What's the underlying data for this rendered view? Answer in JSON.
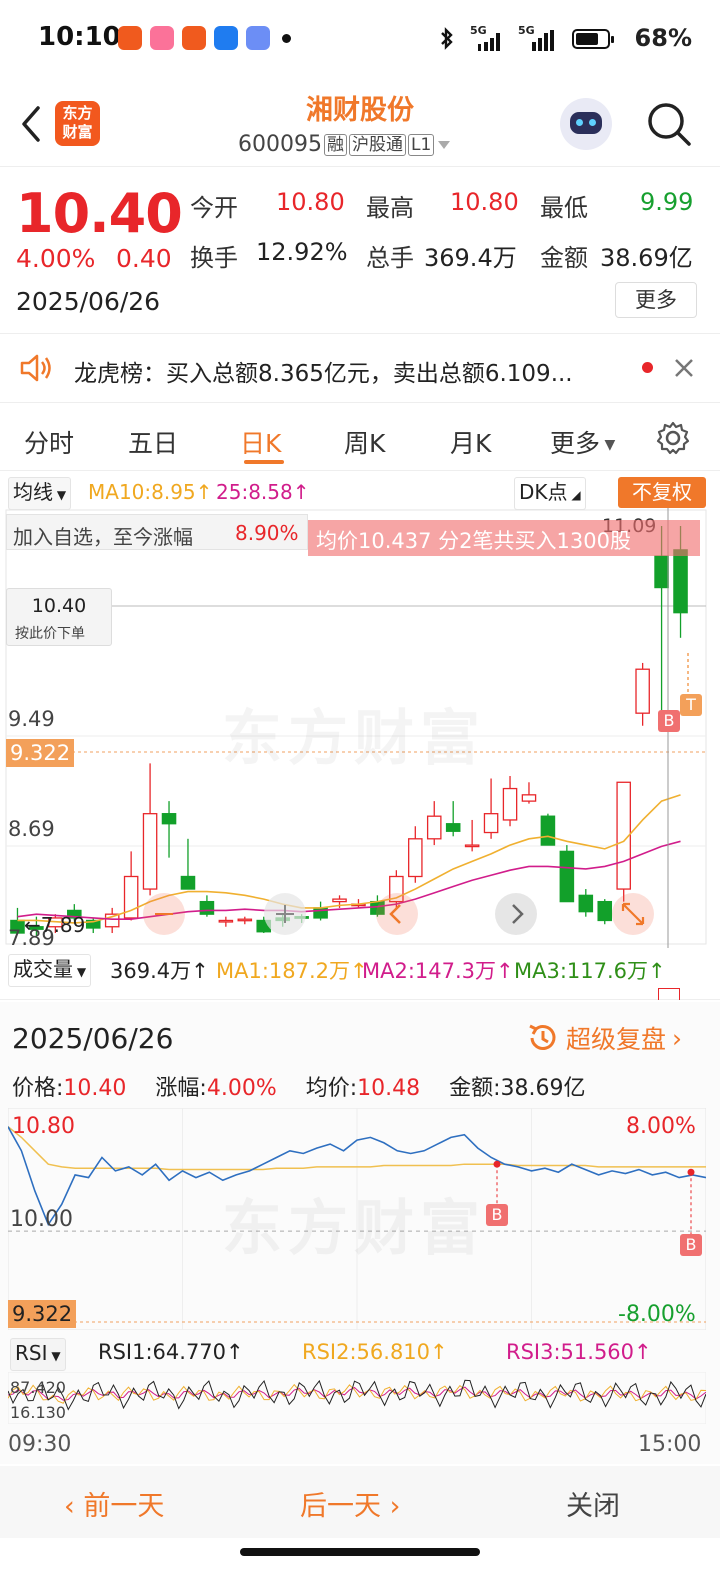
{
  "status_bar": {
    "time": "10:10",
    "battery": "68%",
    "signal1": "5G",
    "signal2": "5G"
  },
  "header": {
    "title": "湘财股份",
    "code": "600095",
    "tag_rong": "融",
    "tag_hgt": "沪股通",
    "tag_level": "L1",
    "logo_line1": "东方",
    "logo_line2": "财富"
  },
  "quote": {
    "price": "10.40",
    "change_pct": "4.00%",
    "change_val": "0.40",
    "date": "2025/06/26",
    "open_label": "今开",
    "open": "10.80",
    "high_label": "最高",
    "high": "10.80",
    "low_label": "最低",
    "low": "9.99",
    "turnover_label": "换手",
    "turnover": "12.92%",
    "volume_label": "总手",
    "volume": "369.4万",
    "amount_label": "金额",
    "amount": "38.69亿",
    "more_label": "更多"
  },
  "notice": {
    "text": "龙虎榜：买入总额8.365亿元，卖出总额6.109..."
  },
  "tabs": [
    "分时",
    "五日",
    "日K",
    "周K",
    "月K",
    "更多"
  ],
  "active_tab": "日K",
  "kline": {
    "ma_select": "均线",
    "ma10": "MA10:8.95↑",
    "ma25": "25:8.58↑",
    "dk_label": "DK点",
    "fq_label": "不复权",
    "watch_text": "加入自选，至今涨幅",
    "watch_pct": "8.90%",
    "avg_banner": "均价10.437  分2笔共买入1300股",
    "price_box": "10.40",
    "price_box_sub": "按此价下单",
    "high_label": "11.09",
    "y_labels": [
      "9.49",
      "8.69",
      "7.89"
    ],
    "cost_label": "9.322",
    "low_label": "7.89",
    "b_mark": "B",
    "t_mark": "T",
    "watermark": "东方财富",
    "vol_select": "成交量",
    "vol_val": "369.4万↑",
    "ma1": "MA1:187.2万↑",
    "ma2": "MA2:147.3万↑",
    "ma3": "MA3:117.6万↑",
    "colors": {
      "up": "#e8262a",
      "down": "#12a02a",
      "ma10": "#f0b030",
      "ma25": "#d11d8b"
    }
  },
  "chart_data": [
    {
      "type": "candlestick",
      "title": "",
      "ylim": [
        7.89,
        11.09
      ],
      "candles": [
        {
          "o": 7.95,
          "h": 8.05,
          "l": 7.85,
          "c": 7.85
        },
        {
          "o": 7.9,
          "h": 7.98,
          "l": 7.83,
          "c": 7.88
        },
        {
          "o": 7.9,
          "h": 8.0,
          "l": 7.85,
          "c": 7.97
        },
        {
          "o": 8.03,
          "h": 8.08,
          "l": 7.95,
          "c": 7.97
        },
        {
          "o": 7.95,
          "h": 7.97,
          "l": 7.85,
          "c": 7.89
        },
        {
          "o": 7.9,
          "h": 8.05,
          "l": 7.85,
          "c": 8.0
        },
        {
          "o": 7.97,
          "h": 8.5,
          "l": 7.95,
          "c": 8.3
        },
        {
          "o": 8.2,
          "h": 9.2,
          "l": 8.15,
          "c": 8.8
        },
        {
          "o": 8.8,
          "h": 8.9,
          "l": 8.45,
          "c": 8.72
        },
        {
          "o": 8.3,
          "h": 8.6,
          "l": 8.2,
          "c": 8.2
        },
        {
          "o": 8.1,
          "h": 8.15,
          "l": 7.98,
          "c": 8.0
        },
        {
          "o": 7.95,
          "h": 7.98,
          "l": 7.9,
          "c": 7.95
        },
        {
          "o": 7.95,
          "h": 7.98,
          "l": 7.92,
          "c": 7.96
        },
        {
          "o": 7.95,
          "h": 7.98,
          "l": 7.85,
          "c": 7.86
        },
        {
          "o": 7.97,
          "h": 8.0,
          "l": 7.9,
          "c": 7.95
        },
        {
          "o": 7.98,
          "h": 8.0,
          "l": 7.93,
          "c": 7.97
        },
        {
          "o": 8.05,
          "h": 8.1,
          "l": 7.95,
          "c": 7.97
        },
        {
          "o": 8.1,
          "h": 8.15,
          "l": 8.05,
          "c": 8.12
        },
        {
          "o": 8.08,
          "h": 8.12,
          "l": 8.05,
          "c": 8.08
        },
        {
          "o": 8.1,
          "h": 8.15,
          "l": 7.98,
          "c": 8.0
        },
        {
          "o": 8.1,
          "h": 8.35,
          "l": 8.05,
          "c": 8.3
        },
        {
          "o": 8.3,
          "h": 8.7,
          "l": 8.25,
          "c": 8.6
        },
        {
          "o": 8.6,
          "h": 8.9,
          "l": 8.55,
          "c": 8.78
        },
        {
          "o": 8.72,
          "h": 8.9,
          "l": 8.62,
          "c": 8.66
        },
        {
          "o": 8.55,
          "h": 8.75,
          "l": 8.5,
          "c": 8.55
        },
        {
          "o": 8.65,
          "h": 9.08,
          "l": 8.6,
          "c": 8.8
        },
        {
          "o": 8.75,
          "h": 9.1,
          "l": 8.7,
          "c": 9.0
        },
        {
          "o": 8.9,
          "h": 9.05,
          "l": 8.88,
          "c": 8.95
        },
        {
          "o": 8.78,
          "h": 8.8,
          "l": 8.55,
          "c": 8.55
        },
        {
          "o": 8.5,
          "h": 8.55,
          "l": 8.1,
          "c": 8.1
        },
        {
          "o": 8.15,
          "h": 8.2,
          "l": 7.98,
          "c": 8.02
        },
        {
          "o": 8.1,
          "h": 8.12,
          "l": 7.92,
          "c": 7.95
        },
        {
          "o": 8.2,
          "h": 9.05,
          "l": 8.1,
          "c": 9.05
        },
        {
          "o": 9.6,
          "h": 10.0,
          "l": 9.5,
          "c": 9.95
        },
        {
          "o": 10.85,
          "h": 11.09,
          "l": 9.6,
          "c": 10.6
        },
        {
          "o": 10.9,
          "h": 11.09,
          "l": 10.2,
          "c": 10.4
        }
      ],
      "ma10": [
        7.95,
        7.95,
        7.94,
        7.93,
        7.94,
        7.98,
        8.03,
        8.1,
        8.15,
        8.18,
        8.18,
        8.17,
        8.15,
        8.12,
        8.08,
        8.05,
        8.05,
        8.07,
        8.08,
        8.1,
        8.13,
        8.2,
        8.28,
        8.36,
        8.42,
        8.48,
        8.55,
        8.6,
        8.62,
        8.58,
        8.55,
        8.52,
        8.58,
        8.75,
        8.9,
        8.95
      ],
      "ma25": [
        7.98,
        8.0,
        7.99,
        7.98,
        7.97,
        7.96,
        7.96,
        7.98,
        8.0,
        8.02,
        8.03,
        8.03,
        8.04,
        8.03,
        8.03,
        8.02,
        8.03,
        8.04,
        8.05,
        8.06,
        8.08,
        8.12,
        8.17,
        8.22,
        8.27,
        8.31,
        8.35,
        8.38,
        8.38,
        8.37,
        8.36,
        8.38,
        8.42,
        8.48,
        8.54,
        8.58
      ]
    },
    {
      "type": "line",
      "title": "",
      "xlabel": "",
      "ylabel": "",
      "ylim": [
        9.322,
        10.8
      ],
      "x_start": "09:30",
      "x_end": "15:00",
      "price": [
        10.78,
        10.6,
        10.3,
        10.05,
        10.2,
        10.42,
        10.4,
        10.55,
        10.45,
        10.48,
        10.42,
        10.5,
        10.38,
        10.45,
        10.4,
        10.44,
        10.38,
        10.42,
        10.45,
        10.5,
        10.55,
        10.6,
        10.58,
        10.62,
        10.65,
        10.6,
        10.68,
        10.7,
        10.66,
        10.6,
        10.58,
        10.6,
        10.65,
        10.7,
        10.72,
        10.62,
        10.55,
        10.5,
        10.48,
        10.45,
        10.47,
        10.44,
        10.5,
        10.46,
        10.42,
        10.45,
        10.43,
        10.46,
        10.42,
        10.44,
        10.4,
        10.42,
        10.4
      ],
      "avg": [
        10.78,
        10.7,
        10.6,
        10.5,
        10.48,
        10.47,
        10.47,
        10.47,
        10.47,
        10.47,
        10.47,
        10.47,
        10.46,
        10.46,
        10.46,
        10.46,
        10.46,
        10.46,
        10.46,
        10.46,
        10.47,
        10.47,
        10.47,
        10.48,
        10.48,
        10.48,
        10.48,
        10.48,
        10.49,
        10.49,
        10.49,
        10.49,
        10.49,
        10.49,
        10.5,
        10.5,
        10.5,
        10.5,
        10.49,
        10.49,
        10.49,
        10.49,
        10.49,
        10.49,
        10.48,
        10.48,
        10.48,
        10.48,
        10.48,
        10.48,
        10.48,
        10.48,
        10.48
      ]
    }
  ],
  "intraday": {
    "date": "2025/06/26",
    "replay_label": "超级复盘",
    "price_label": "价格:",
    "price": "10.40",
    "chg_label": "涨幅:",
    "chg": "4.00%",
    "avg_label": "均价:",
    "avg": "10.48",
    "amt_label": "金额:",
    "amt": "38.69亿",
    "top_price": "10.80",
    "mid_price": "10.00",
    "bottom_price": "9.322",
    "top_pct": "8.00%",
    "bottom_pct": "-8.00%",
    "rsi_select": "RSI",
    "rsi1": "RSI1:64.770↑",
    "rsi2": "RSI2:56.810↑",
    "rsi3": "RSI3:51.560↑",
    "rsi_top": "87.420",
    "rsi_bottom": "16.130",
    "time_start": "09:30",
    "time_end": "15:00"
  },
  "bottom_bar": {
    "prev": "前一天",
    "next": "后一天",
    "close": "关闭"
  }
}
